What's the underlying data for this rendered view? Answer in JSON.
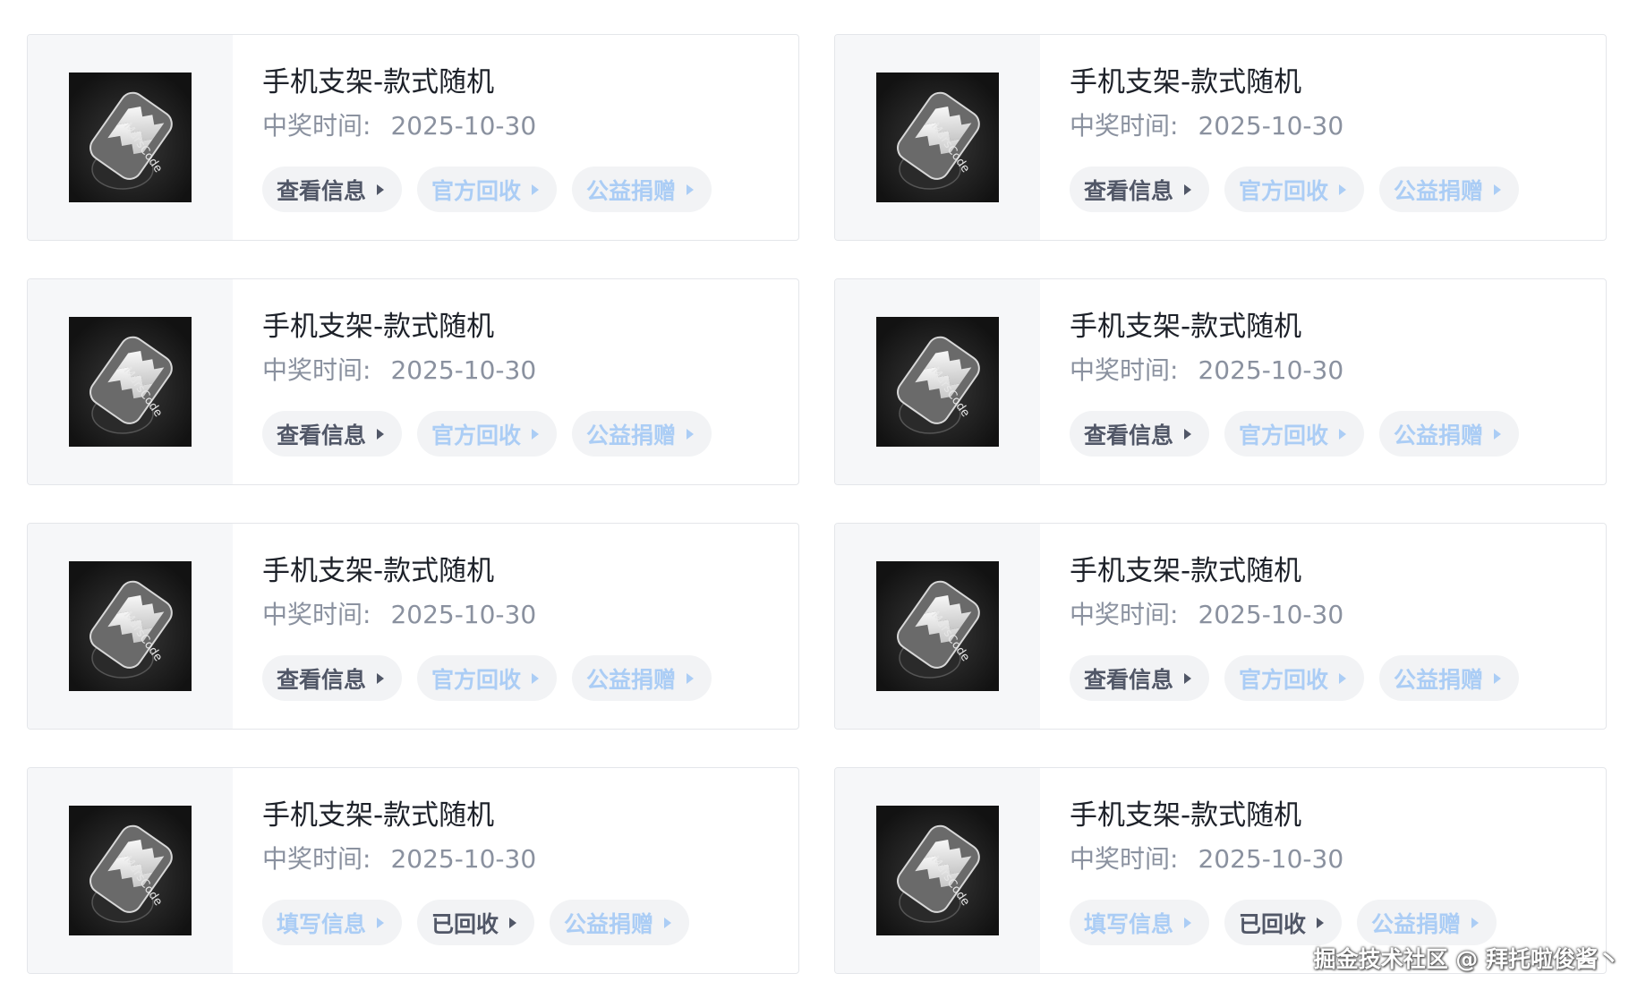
{
  "items": [
    {
      "title": "手机支架-款式随机",
      "time_label": "中奖时间:",
      "time_value": "2025-10-30",
      "actions": [
        {
          "label": "查看信息",
          "style": "dark"
        },
        {
          "label": "官方回收",
          "style": "light"
        },
        {
          "label": "公益捐赠",
          "style": "light"
        }
      ],
      "image_text": "MarsCode"
    },
    {
      "title": "手机支架-款式随机",
      "time_label": "中奖时间:",
      "time_value": "2025-10-30",
      "actions": [
        {
          "label": "查看信息",
          "style": "dark"
        },
        {
          "label": "官方回收",
          "style": "light"
        },
        {
          "label": "公益捐赠",
          "style": "light"
        }
      ],
      "image_text": "MarsCode"
    },
    {
      "title": "手机支架-款式随机",
      "time_label": "中奖时间:",
      "time_value": "2025-10-30",
      "actions": [
        {
          "label": "查看信息",
          "style": "dark"
        },
        {
          "label": "官方回收",
          "style": "light"
        },
        {
          "label": "公益捐赠",
          "style": "light"
        }
      ],
      "image_text": "MarsCode"
    },
    {
      "title": "手机支架-款式随机",
      "time_label": "中奖时间:",
      "time_value": "2025-10-30",
      "actions": [
        {
          "label": "查看信息",
          "style": "dark"
        },
        {
          "label": "官方回收",
          "style": "light"
        },
        {
          "label": "公益捐赠",
          "style": "light"
        }
      ],
      "image_text": "MarsCode"
    },
    {
      "title": "手机支架-款式随机",
      "time_label": "中奖时间:",
      "time_value": "2025-10-30",
      "actions": [
        {
          "label": "查看信息",
          "style": "dark"
        },
        {
          "label": "官方回收",
          "style": "light"
        },
        {
          "label": "公益捐赠",
          "style": "light"
        }
      ],
      "image_text": "MarsCode"
    },
    {
      "title": "手机支架-款式随机",
      "time_label": "中奖时间:",
      "time_value": "2025-10-30",
      "actions": [
        {
          "label": "查看信息",
          "style": "dark"
        },
        {
          "label": "官方回收",
          "style": "light"
        },
        {
          "label": "公益捐赠",
          "style": "light"
        }
      ],
      "image_text": "MarsCode"
    },
    {
      "title": "手机支架-款式随机",
      "time_label": "中奖时间:",
      "time_value": "2025-10-30",
      "actions": [
        {
          "label": "填写信息",
          "style": "light"
        },
        {
          "label": "已回收",
          "style": "dark"
        },
        {
          "label": "公益捐赠",
          "style": "light"
        }
      ],
      "image_text": "MarsCode"
    },
    {
      "title": "手机支架-款式随机",
      "time_label": "中奖时间:",
      "time_value": "2025-10-30",
      "actions": [
        {
          "label": "填写信息",
          "style": "light"
        },
        {
          "label": "已回收",
          "style": "dark"
        },
        {
          "label": "公益捐赠",
          "style": "light"
        }
      ],
      "image_text": "MarsCode"
    }
  ],
  "watermark": "掘金技术社区 @ 拜托啦俊酱丶",
  "colors": {
    "title": "#1d2129",
    "meta": "#8a919f",
    "pill_bg": "#f2f3f5",
    "pill_dark": "#515767",
    "pill_light": "#abcdf5",
    "card_border": "#e4e6ea",
    "thumb_area_bg": "#f6f7f9"
  },
  "icons": [
    "triangle-right-icon"
  ]
}
